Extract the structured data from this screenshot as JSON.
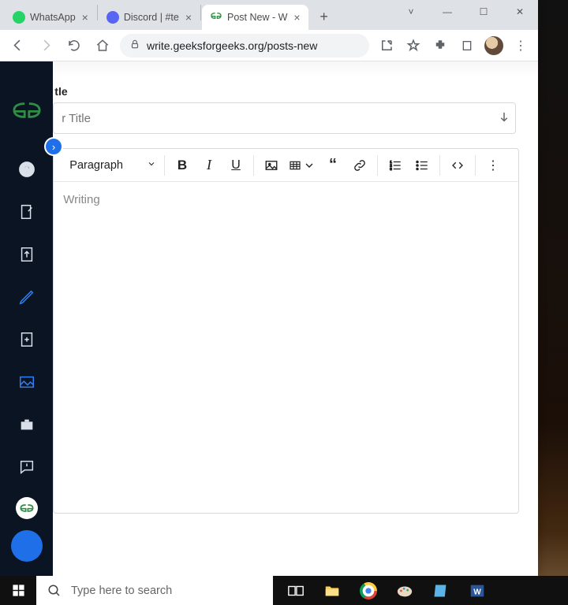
{
  "browser": {
    "tabs": [
      {
        "label": "WhatsApp"
      },
      {
        "label": "Discord | #te"
      },
      {
        "label": "Post New - W"
      }
    ],
    "url": "write.geeksforgeeks.org/posts-new"
  },
  "editor": {
    "title_section_label": "tle",
    "title_placeholder": "r Title",
    "block_selector": "Paragraph",
    "content_placeholder": "Writing"
  },
  "taskbar": {
    "search_placeholder": "Type here to search"
  }
}
